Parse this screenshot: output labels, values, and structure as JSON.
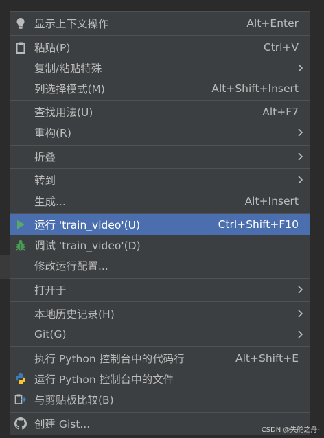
{
  "menu": {
    "items": [
      {
        "label": "显示上下文操作",
        "shortcut": "Alt+Enter"
      },
      {
        "label": "粘贴(P)",
        "shortcut": "Ctrl+V"
      },
      {
        "label": "复制/粘贴特殊",
        "shortcut": ""
      },
      {
        "label": "列选择模式(M)",
        "shortcut": "Alt+Shift+Insert"
      },
      {
        "label": "查找用法(U)",
        "shortcut": "Alt+F7"
      },
      {
        "label": "重构(R)",
        "shortcut": ""
      },
      {
        "label": "折叠",
        "shortcut": ""
      },
      {
        "label": "转到",
        "shortcut": ""
      },
      {
        "label": "生成...",
        "shortcut": "Alt+Insert"
      },
      {
        "label": "运行 'train_video'(U)",
        "shortcut": "Ctrl+Shift+F10"
      },
      {
        "label": "调试 'train_video'(D)",
        "shortcut": ""
      },
      {
        "label": "修改运行配置...",
        "shortcut": ""
      },
      {
        "label": "打开于",
        "shortcut": ""
      },
      {
        "label": "本地历史记录(H)",
        "shortcut": ""
      },
      {
        "label": "Git(G)",
        "shortcut": ""
      },
      {
        "label": "执行 Python 控制台中的代码行",
        "shortcut": "Alt+Shift+E"
      },
      {
        "label": "运行 Python 控制台中的文件",
        "shortcut": ""
      },
      {
        "label": "与剪贴板比较(B)",
        "shortcut": ""
      },
      {
        "label": "创建 Gist...",
        "shortcut": ""
      }
    ]
  },
  "icons": {
    "bulb": "lightbulb-icon",
    "paste": "clipboard-icon",
    "run": "run-triangle-icon",
    "debug": "debug-bug-icon",
    "python": "python-logo-icon",
    "compare": "compare-clipboard-icon",
    "github": "github-icon",
    "submenu": "chevron-right-icon"
  },
  "colors": {
    "menu_bg": "#3c3f41",
    "selected_bg": "#4b6eaf",
    "text": "#bbbbbb",
    "run_green": "#59a869",
    "debug_green": "#499c54"
  },
  "watermark": "CSDN @失舵之舟-"
}
